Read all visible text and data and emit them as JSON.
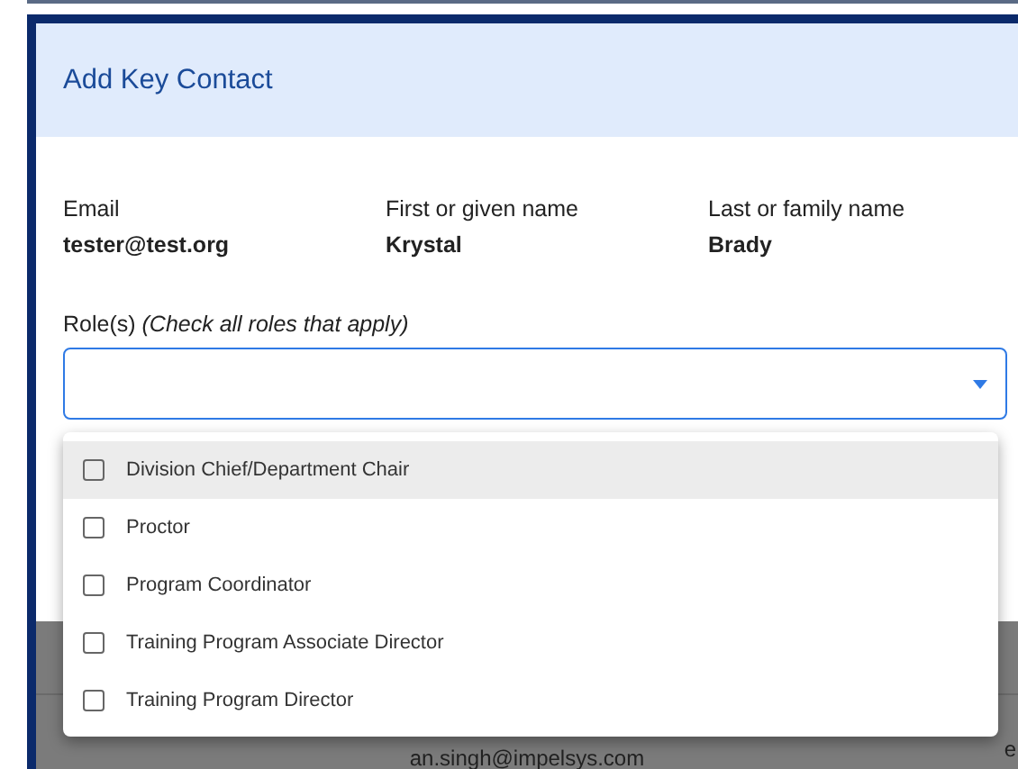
{
  "dialog": {
    "title": "Add Key Contact",
    "fields": [
      {
        "label": "Email",
        "value": "tester@test.org"
      },
      {
        "label": "First or given name",
        "value": "Krystal"
      },
      {
        "label": "Last or family name",
        "value": "Brady"
      }
    ],
    "roles": {
      "label": "Role(s) *(Check all roles that apply)*",
      "options": [
        {
          "label": "Division Chief/Department Chair",
          "checked": false,
          "highlighted": true
        },
        {
          "label": "Proctor",
          "checked": false,
          "highlighted": false
        },
        {
          "label": "Program Coordinator",
          "checked": false,
          "highlighted": false
        },
        {
          "label": "Training Program Associate Director",
          "checked": false,
          "highlighted": false
        },
        {
          "label": "Training Program Director",
          "checked": false,
          "highlighted": false
        }
      ]
    }
  },
  "background": {
    "email": "an.singh@impelsys.com",
    "column_2": "e"
  }
}
